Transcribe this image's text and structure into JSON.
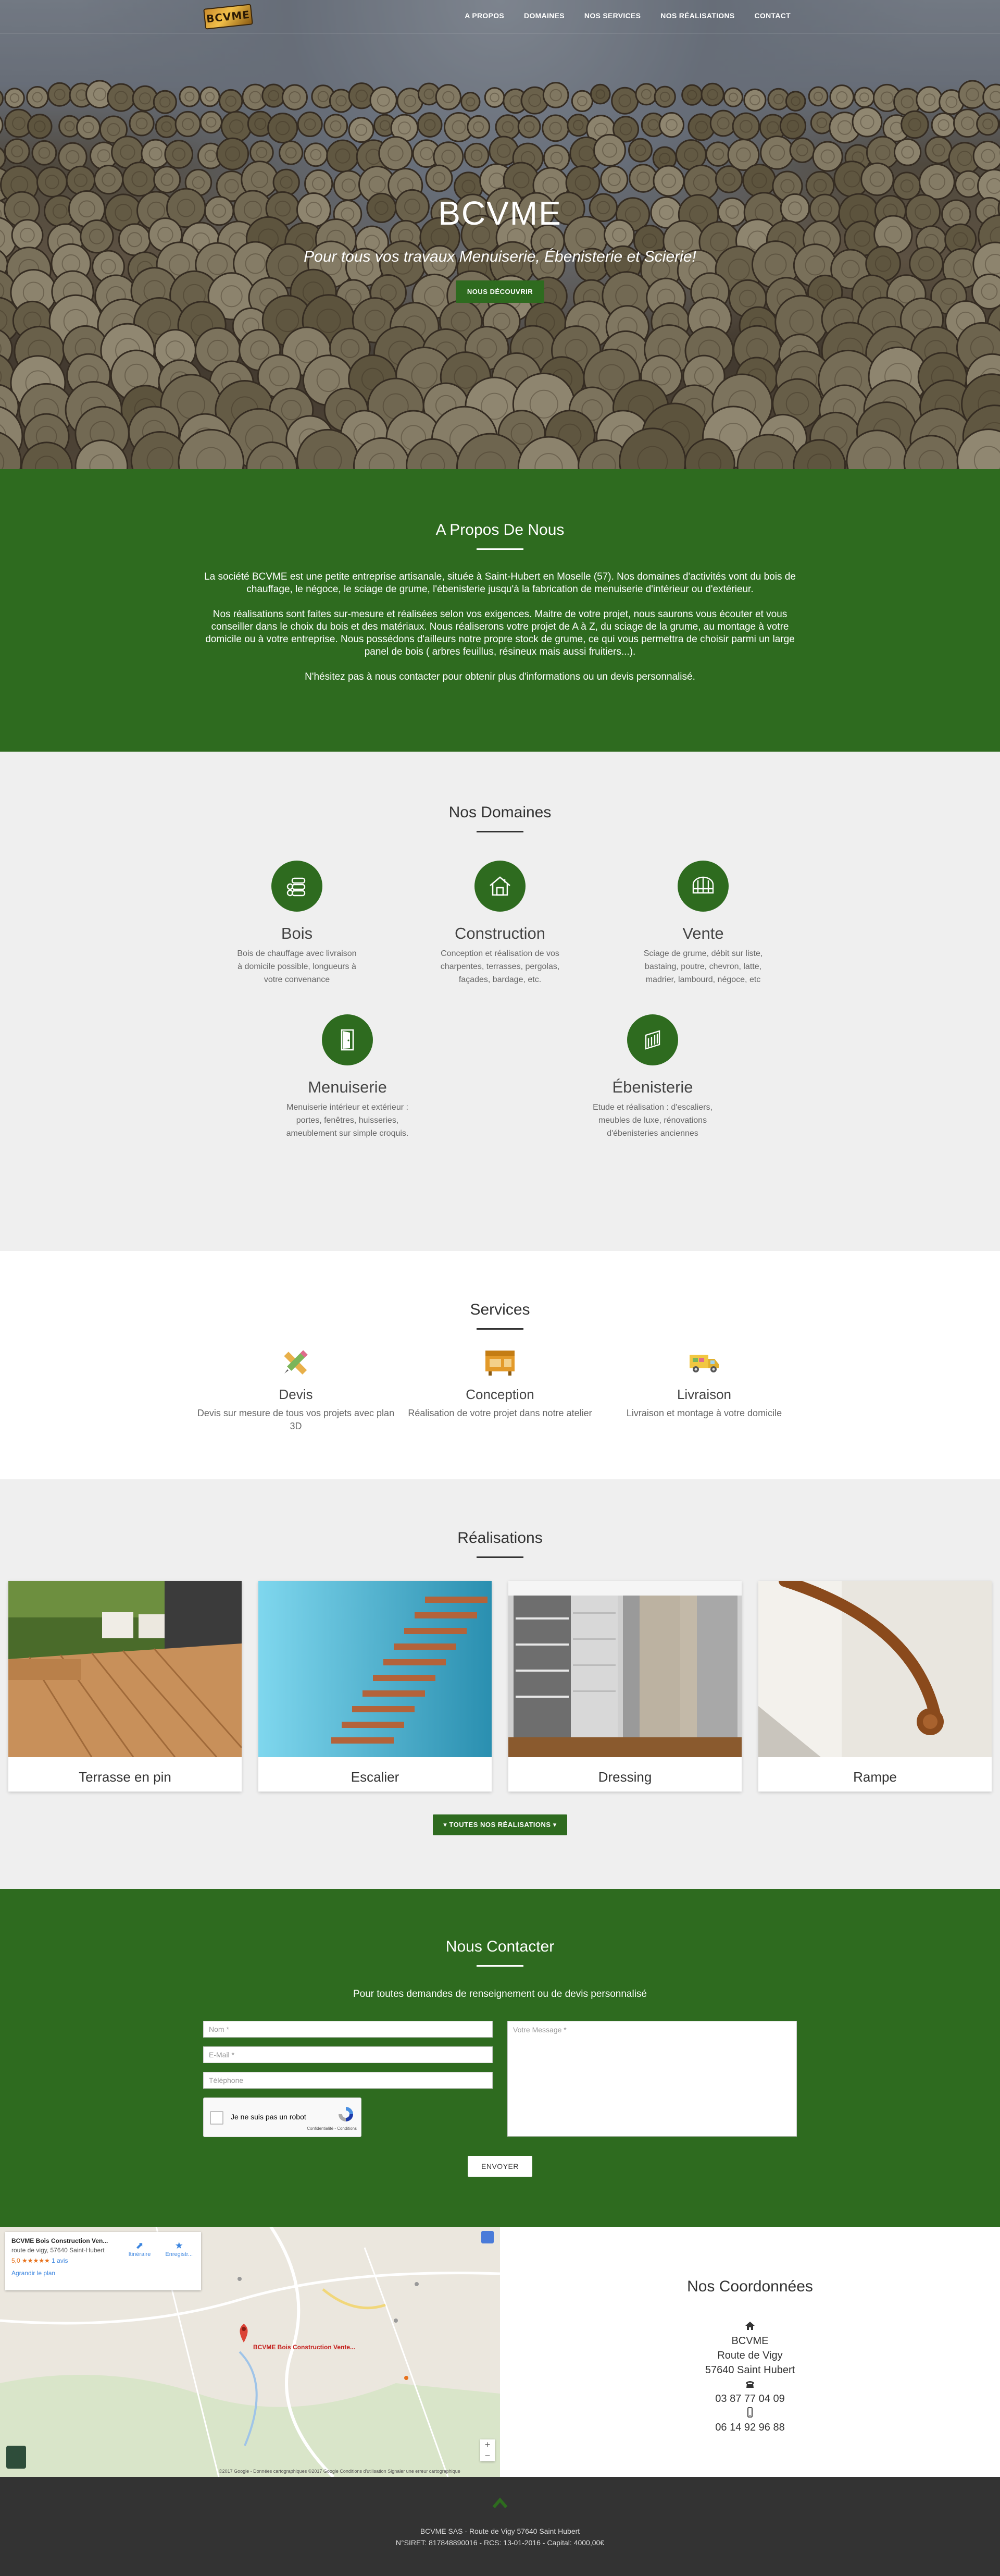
{
  "nav": {
    "logo_text": "BCVME",
    "links": [
      "A PROPOS",
      "DOMAINES",
      "NOS SERVICES",
      "NOS RÉALISATIONS",
      "CONTACT"
    ]
  },
  "hero": {
    "title": "BCVME",
    "subtitle": "Pour tous vos travaux Menuiserie, Ébenisterie et Scierie!",
    "button": "NOUS DÉCOUVRIR"
  },
  "about": {
    "title": "A Propos De Nous",
    "p1": "La société BCVME est une petite entreprise artisanale, située à Saint-Hubert en Moselle (57). Nos domaines d'activités vont du bois de chauffage, le négoce, le sciage de grume, l'ébenisterie jusqu'à la fabrication de menuiserie d'intérieur ou d'extérieur.",
    "p2": "Nos réalisations sont faites sur-mesure et réalisées selon vos exigences. Maitre de votre projet, nous saurons vous écouter et vous conseiller dans le choix du bois et des matériaux. Nous réaliserons votre projet de A à Z, du sciage de la grume, au montage à votre domicile ou à votre entreprise. Nous possédons d'ailleurs notre propre stock de grume, ce qui vous permettra de choisir parmi un large panel de bois ( arbres feuillus, résineux mais aussi fruitiers...).",
    "p3": "N'hésitez pas à nous contacter pour obtenir plus d'informations ou un devis personnalisé."
  },
  "domains": {
    "title": "Nos Domaines",
    "items": [
      {
        "name": "Bois",
        "desc": "Bois de chauffage avec livraison à domicile possible, longueurs à votre convenance",
        "icon": "firewood-icon"
      },
      {
        "name": "Construction",
        "desc": "Conception et réalisation de vos charpentes, terrasses, pergolas, façades, bardage, etc.",
        "icon": "house-frame-icon"
      },
      {
        "name": "Vente",
        "desc": "Sciage de grume, débit sur liste, bastaing, poutre, chevron, latte, madrier, lambourd, négoce, etc",
        "icon": "lumber-stack-icon"
      },
      {
        "name": "Menuiserie",
        "desc": "Menuiserie intérieur et extérieur : portes, fenêtres, huisseries, ameublement sur simple croquis.",
        "icon": "door-icon"
      },
      {
        "name": "Ébenisterie",
        "desc": "Etude et réalisation : d'escaliers, meubles de luxe, rénovations d'ébenisteries anciennes",
        "icon": "staircase-icon"
      }
    ]
  },
  "services": {
    "title": "Services",
    "items": [
      {
        "name": "Devis",
        "desc": "Devis sur mesure de tous vos projets avec plan 3D",
        "icon": "pencil-ruler-icon"
      },
      {
        "name": "Conception",
        "desc": "Réalisation de votre projet dans notre atelier",
        "icon": "workbench-icon"
      },
      {
        "name": "Livraison",
        "desc": "Livraison et montage à votre domicile",
        "icon": "truck-icon"
      }
    ]
  },
  "works": {
    "title": "Réalisations",
    "cards": [
      "Terrasse en pin",
      "Escalier",
      "Dressing",
      "Rampe"
    ],
    "button": "TOUTES NOS RÉALISATIONS"
  },
  "contact": {
    "title": "Nous Contacter",
    "intro": "Pour toutes demandes de renseignement ou de devis personnalisé",
    "name_placeholder": "Nom *",
    "email_placeholder": "E-Mail *",
    "phone_placeholder": "Téléphone",
    "message_placeholder": "Votre Message *",
    "captcha_label": "Je ne suis pas un robot",
    "captcha_sub": "Confidentialité - Conditions",
    "send": "ENVOYER"
  },
  "map": {
    "place_name": "BCVME Bois Construction Ven...",
    "address": "route de vigy, 57640 Saint-Hubert",
    "rating": "5,0 ★★★★★",
    "reviews": "1 avis",
    "larger_map": "Agrandir le plan",
    "directions": "Itinéraire",
    "save": "Enregistr...",
    "pin_label": "BCVME Bois Construction Vente...",
    "footer": "©2017 Google - Données cartographiques ©2017 Google  Conditions d'utilisation  Signaler une erreur cartographique",
    "zoom_in": "+",
    "zoom_out": "−"
  },
  "coordinates": {
    "title": "Nos Coordonnées",
    "company": "BCVME",
    "street": "Route de Vigy",
    "city": "57640 Saint Hubert",
    "phone": "03 87 77 04 09",
    "mobile": "06 14 92 96 88"
  },
  "footer": {
    "line1": "BCVME SAS - Route de Vigy 57640 Saint Hubert",
    "line2": "N°SIRET: 817848890016 - RCS: 13-01-2016 - Capital: 4000,00€"
  },
  "colors": {
    "primary_green": "#2e6b1f",
    "light_grey": "#efefef",
    "footer": "#333333"
  }
}
